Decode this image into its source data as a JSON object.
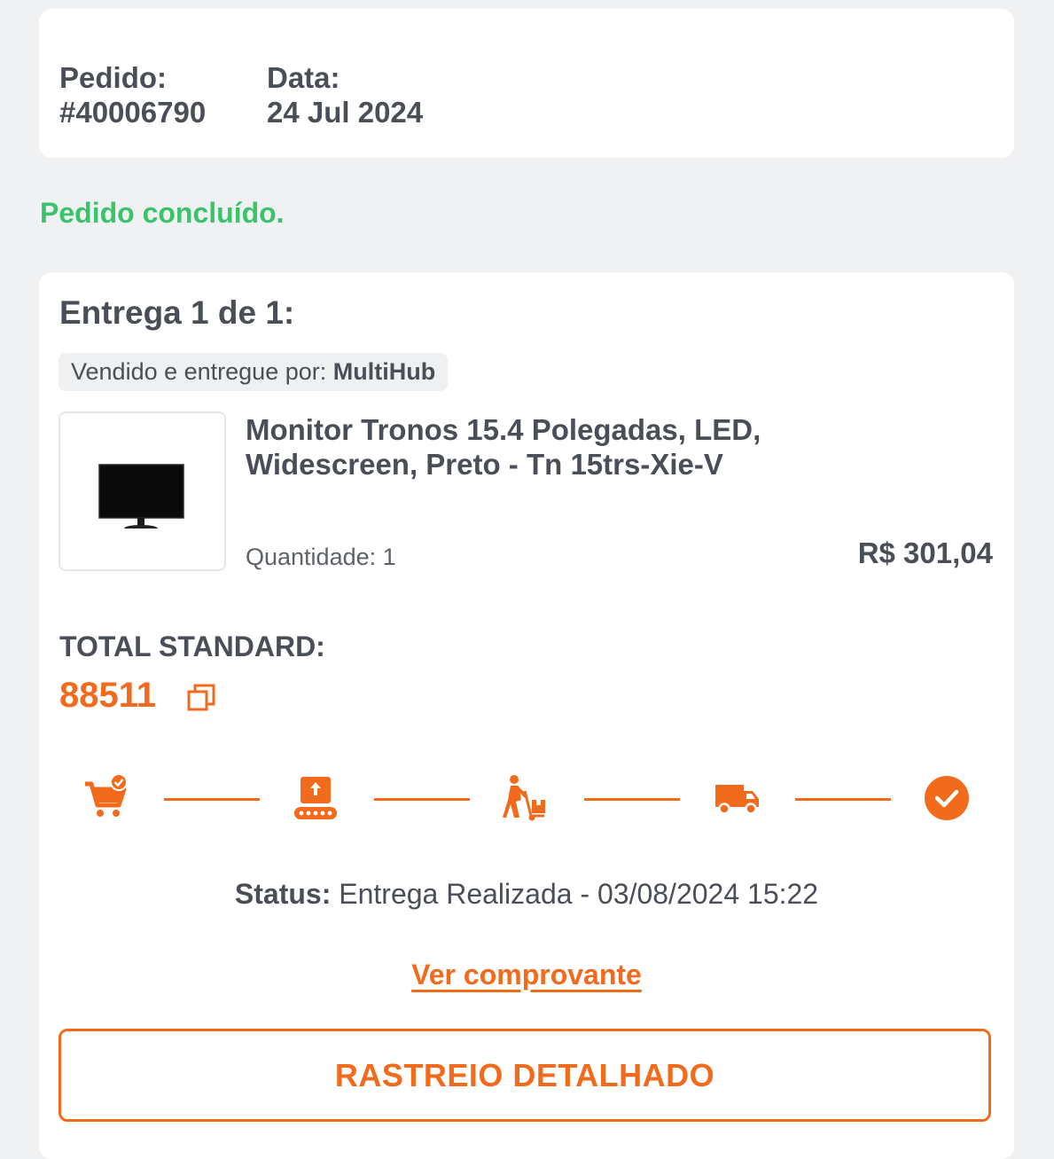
{
  "order": {
    "order_label": "Pedido:",
    "order_number": "#40006790",
    "date_label": "Data:",
    "date_value": "24 Jul 2024"
  },
  "status_message": "Pedido concluído.",
  "delivery": {
    "title": "Entrega 1 de 1:",
    "seller_prefix": "Vendido e entregue por: ",
    "seller_name": "MultiHub",
    "product": {
      "name": "Monitor Tronos 15.4 Polegadas, LED, Widescreen, Preto - Tn 15trs-Xie-V",
      "quantity": "Quantidade: 1",
      "price": "R$ 301,04",
      "image_icon": "monitor-image"
    },
    "total_label": "TOTAL STANDARD:",
    "total_value": "88511",
    "tracking_steps": [
      {
        "icon": "cart-check-icon",
        "state": "done"
      },
      {
        "icon": "package-conveyor-icon",
        "state": "done"
      },
      {
        "icon": "courier-hand-truck-icon",
        "state": "done"
      },
      {
        "icon": "delivery-truck-icon",
        "state": "done"
      },
      {
        "icon": "check-circle-icon",
        "state": "done"
      }
    ],
    "status_label": "Status:",
    "status_value": " Entrega Realizada - 03/08/2024 15:22",
    "receipt_link": "Ver comprovante",
    "tracking_button": "RASTREIO DETALHADO"
  },
  "colors": {
    "accent": "#f26b1d",
    "success": "#3cc26b",
    "text": "#4a4e57",
    "background": "#f0f1f3"
  }
}
